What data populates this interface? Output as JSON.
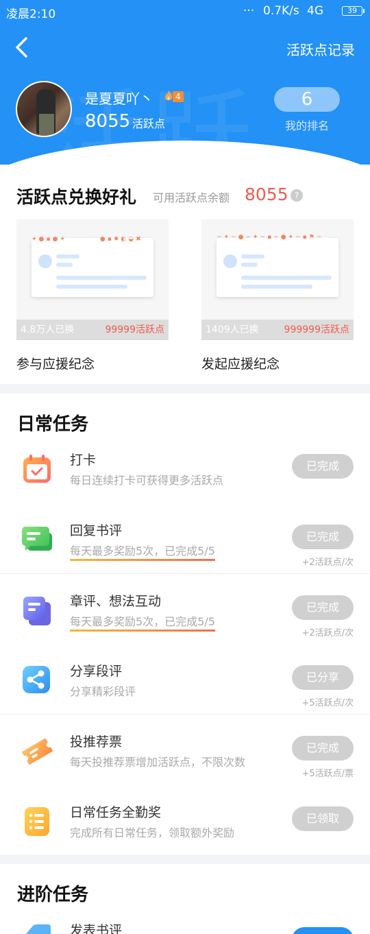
{
  "status_bar": {
    "time": "凌晨2:10",
    "signal_dots": "···",
    "speed": "0.7K/s",
    "network": "4G",
    "battery": "39"
  },
  "header": {
    "record_link": "活跃点记录",
    "username": "是夏夏吖丶",
    "level": "4",
    "points": "8055",
    "points_unit": "活跃点",
    "rank": "6",
    "rank_label": "我的排名",
    "watermark": "活跃"
  },
  "exchange": {
    "title": "活跃点兑换好礼",
    "balance_label": "可用活跃点余额",
    "balance": "8055",
    "help_symbol": "?",
    "items": [
      {
        "name": "参与应援纪念",
        "redeemed": "4.8万人已换",
        "cost": "99999活跃点"
      },
      {
        "name": "发起应援纪念",
        "redeemed": "1409人已换",
        "cost": "999999活跃点"
      }
    ]
  },
  "daily": {
    "title": "日常任务",
    "tasks": [
      {
        "name": "打卡",
        "desc": "每日连续打卡可获得更多活跃点",
        "button": "已完成",
        "reward": ""
      },
      {
        "name": "回复书评",
        "desc": "每天最多奖励5次，已完成5/5",
        "button": "已完成",
        "reward": "+2活跃点/次"
      },
      {
        "name": "章评、想法互动",
        "desc": "每天最多奖励5次，已完成5/5",
        "button": "已完成",
        "reward": "+2活跃点/次"
      },
      {
        "name": "分享段评",
        "desc": "分享精彩段评",
        "button": "已分享",
        "reward": "+5活跃点/次"
      },
      {
        "name": "投推荐票",
        "desc": "每天投推荐票增加活跃点，不限次数",
        "button": "已完成",
        "reward": "+5活跃点/票"
      },
      {
        "name": "日常任务全勤奖",
        "desc": "完成所有日常任务，领取额外奖励",
        "button": "已领取",
        "reward": ""
      }
    ]
  },
  "advanced": {
    "title": "进阶任务",
    "first_task": "发表书评"
  },
  "colors": {
    "brand_blue": "#2391f5",
    "accent_red": "#f05b4f",
    "done_gray": "#d0d0d0"
  }
}
